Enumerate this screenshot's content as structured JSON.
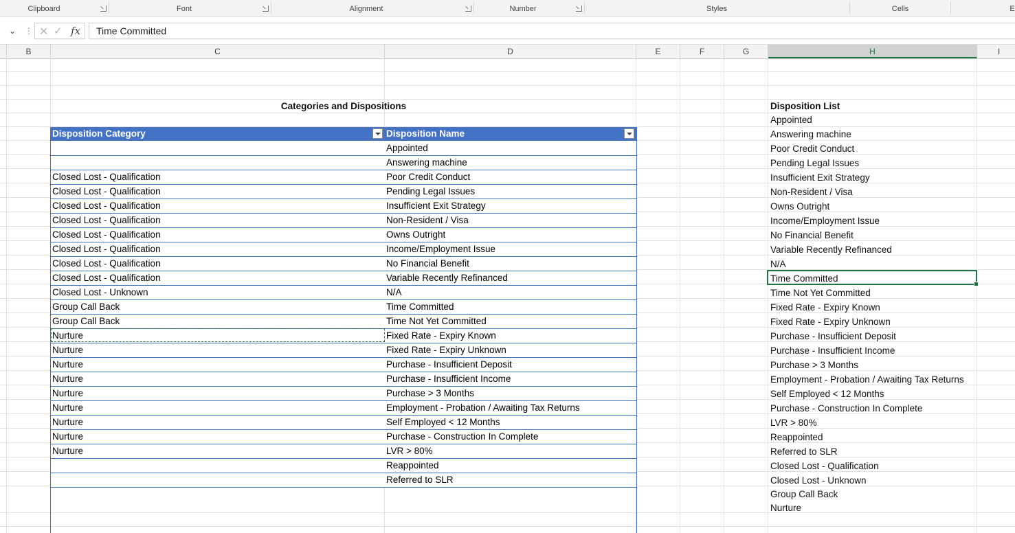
{
  "ribbon": {
    "groups": [
      {
        "label": "Clipboard"
      },
      {
        "label": "Font"
      },
      {
        "label": "Alignment"
      },
      {
        "label": "Number"
      },
      {
        "label": "Styles"
      },
      {
        "label": "Cells"
      },
      {
        "label": "E"
      }
    ]
  },
  "formula_bar": {
    "value": "Time Committed",
    "fx_label": "fx"
  },
  "columns": [
    "B",
    "C",
    "D",
    "E",
    "F",
    "G",
    "H",
    "I"
  ],
  "active_column": "H",
  "sheet": {
    "title": "Categories and Dispositions",
    "table": {
      "headers": [
        "Disposition Category",
        "Disposition Name"
      ],
      "rows": [
        [
          "",
          "Appointed"
        ],
        [
          "",
          "Answering machine"
        ],
        [
          "Closed Lost - Qualification",
          "Poor Credit Conduct"
        ],
        [
          "Closed Lost - Qualification",
          "Pending Legal Issues"
        ],
        [
          "Closed Lost - Qualification",
          "Insufficient Exit Strategy"
        ],
        [
          "Closed Lost - Qualification",
          "Non-Resident / Visa"
        ],
        [
          "Closed Lost - Qualification",
          "Owns Outright"
        ],
        [
          "Closed Lost - Qualification",
          "Income/Employment Issue"
        ],
        [
          "Closed Lost - Qualification",
          "No Financial Benefit"
        ],
        [
          "Closed Lost - Qualification",
          "Variable Recently Refinanced"
        ],
        [
          "Closed Lost - Unknown",
          "N/A"
        ],
        [
          "Group Call Back",
          "Time Committed"
        ],
        [
          "Group Call Back",
          "Time Not Yet Committed"
        ],
        [
          "Nurture",
          "Fixed Rate - Expiry Known"
        ],
        [
          "Nurture",
          "Fixed Rate - Expiry Unknown"
        ],
        [
          "Nurture",
          "Purchase - Insufficient Deposit"
        ],
        [
          "Nurture",
          "Purchase - Insufficient Income"
        ],
        [
          "Nurture",
          "Purchase > 3 Months"
        ],
        [
          "Nurture",
          "Employment - Probation / Awaiting Tax Returns"
        ],
        [
          "Nurture",
          "Self Employed < 12 Months"
        ],
        [
          "Nurture",
          "Purchase - Construction In Complete"
        ],
        [
          "Nurture",
          "LVR > 80%"
        ],
        [
          "",
          "Reappointed"
        ],
        [
          "",
          "Referred to SLR"
        ]
      ]
    },
    "list_header": "Disposition List",
    "list": [
      "Appointed",
      "Answering machine",
      "Poor Credit Conduct",
      "Pending Legal Issues",
      "Insufficient Exit Strategy",
      "Non-Resident / Visa",
      "Owns Outright",
      "Income/Employment Issue",
      "No Financial Benefit",
      "Variable Recently Refinanced",
      "N/A",
      "Time Committed",
      "Time Not Yet Committed",
      "Fixed Rate - Expiry Known",
      "Fixed Rate - Expiry Unknown",
      "Purchase - Insufficient Deposit",
      "Purchase - Insufficient Income",
      "Purchase > 3 Months",
      "Employment - Probation / Awaiting Tax Returns",
      "Self Employed < 12 Months",
      "Purchase - Construction In Complete",
      "LVR > 80%",
      "Reappointed",
      "Referred to SLR",
      "Closed Lost - Qualification",
      "Closed Lost - Unknown",
      "Group Call Back",
      "Nurture"
    ]
  },
  "colors": {
    "table_header": "#4472c4",
    "selection": "#217346"
  }
}
